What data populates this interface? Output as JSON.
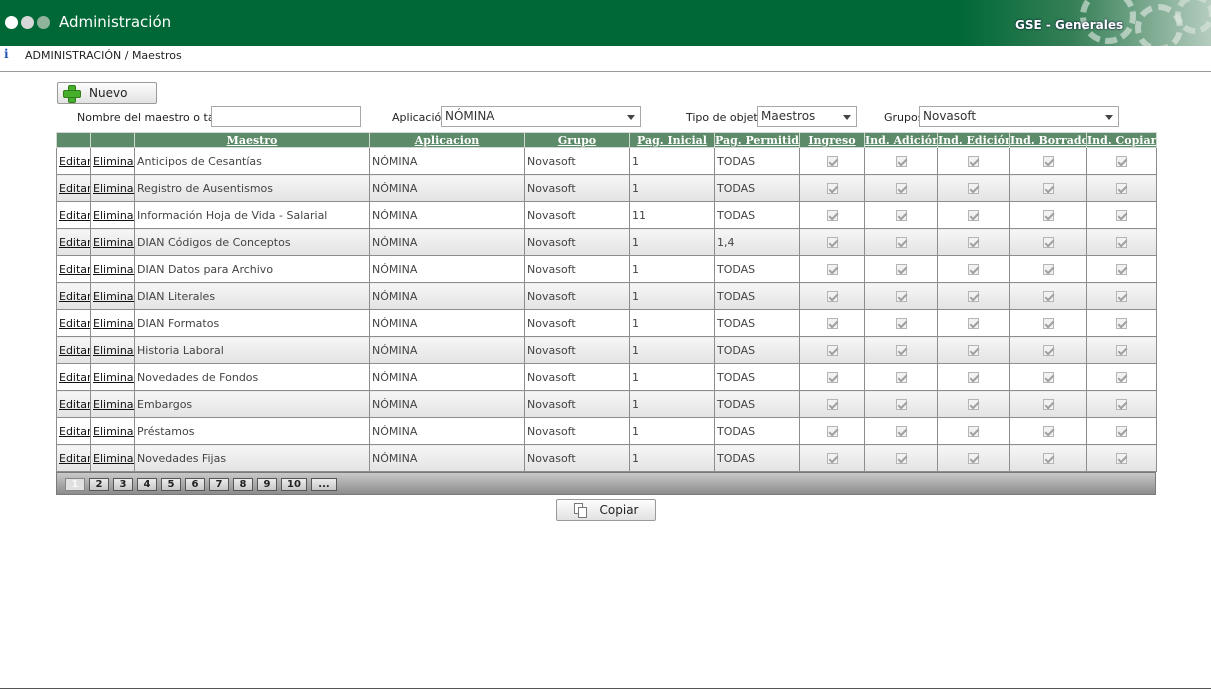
{
  "header": {
    "app_title": "Administración",
    "module_title": "GSE - Generales"
  },
  "breadcrumb": "ADMINISTRACIÓN / Maestros",
  "toolbar": {
    "new_label": "Nuevo",
    "copy_label": "Copiar"
  },
  "filters": {
    "name_label": "Nombre del maestro o tabla",
    "name_value": "",
    "app_label": "Aplicación",
    "app_value": "NÓMINA",
    "type_label": "Tipo de objeto",
    "type_value": "Maestros",
    "group_label": "Grupos",
    "group_value": "Novasoft"
  },
  "grid": {
    "columns": [
      "",
      "",
      "Maestro",
      "Aplicacion",
      "Grupo",
      "Pag. Inicial",
      "Pag. Permitida",
      "Ingreso",
      "Ind. Adición",
      "Ind. Edición",
      "Ind. Borrado",
      "Ind. Copiar"
    ],
    "edit_label": "Editar",
    "delete_label": "Eliminar",
    "rows": [
      {
        "maestro": "Anticipos de Cesantías",
        "aplicacion": "NÓMINA",
        "grupo": "Novasoft",
        "pag_inicial": "1",
        "pag_permitida": "TODAS",
        "ingreso": true,
        "adicion": true,
        "edicion": true,
        "borrado": true,
        "copiar": true
      },
      {
        "maestro": "Registro de Ausentismos",
        "aplicacion": "NÓMINA",
        "grupo": "Novasoft",
        "pag_inicial": "1",
        "pag_permitida": "TODAS",
        "ingreso": true,
        "adicion": true,
        "edicion": true,
        "borrado": true,
        "copiar": true
      },
      {
        "maestro": "Información Hoja de Vida - Salarial",
        "aplicacion": "NÓMINA",
        "grupo": "Novasoft",
        "pag_inicial": "11",
        "pag_permitida": "TODAS",
        "ingreso": true,
        "adicion": true,
        "edicion": true,
        "borrado": true,
        "copiar": true
      },
      {
        "maestro": "DIAN Códigos de Conceptos",
        "aplicacion": "NÓMINA",
        "grupo": "Novasoft",
        "pag_inicial": "1",
        "pag_permitida": "1,4",
        "ingreso": true,
        "adicion": true,
        "edicion": true,
        "borrado": true,
        "copiar": true
      },
      {
        "maestro": "DIAN Datos para Archivo",
        "aplicacion": "NÓMINA",
        "grupo": "Novasoft",
        "pag_inicial": "1",
        "pag_permitida": "TODAS",
        "ingreso": true,
        "adicion": true,
        "edicion": true,
        "borrado": true,
        "copiar": true
      },
      {
        "maestro": "DIAN Literales",
        "aplicacion": "NÓMINA",
        "grupo": "Novasoft",
        "pag_inicial": "1",
        "pag_permitida": "TODAS",
        "ingreso": true,
        "adicion": true,
        "edicion": true,
        "borrado": true,
        "copiar": true
      },
      {
        "maestro": "DIAN Formatos",
        "aplicacion": "NÓMINA",
        "grupo": "Novasoft",
        "pag_inicial": "1",
        "pag_permitida": "TODAS",
        "ingreso": true,
        "adicion": true,
        "edicion": true,
        "borrado": true,
        "copiar": true
      },
      {
        "maestro": "Historia Laboral",
        "aplicacion": "NÓMINA",
        "grupo": "Novasoft",
        "pag_inicial": "1",
        "pag_permitida": "TODAS",
        "ingreso": true,
        "adicion": true,
        "edicion": true,
        "borrado": true,
        "copiar": true
      },
      {
        "maestro": "Novedades de Fondos",
        "aplicacion": "NÓMINA",
        "grupo": "Novasoft",
        "pag_inicial": "1",
        "pag_permitida": "TODAS",
        "ingreso": true,
        "adicion": true,
        "edicion": true,
        "borrado": true,
        "copiar": true
      },
      {
        "maestro": "Embargos",
        "aplicacion": "NÓMINA",
        "grupo": "Novasoft",
        "pag_inicial": "1",
        "pag_permitida": "TODAS",
        "ingreso": true,
        "adicion": true,
        "edicion": true,
        "borrado": true,
        "copiar": true
      },
      {
        "maestro": "Préstamos",
        "aplicacion": "NÓMINA",
        "grupo": "Novasoft",
        "pag_inicial": "1",
        "pag_permitida": "TODAS",
        "ingreso": true,
        "adicion": true,
        "edicion": true,
        "borrado": true,
        "copiar": true
      },
      {
        "maestro": "Novedades Fijas",
        "aplicacion": "NÓMINA",
        "grupo": "Novasoft",
        "pag_inicial": "1",
        "pag_permitida": "TODAS",
        "ingreso": true,
        "adicion": true,
        "edicion": true,
        "borrado": true,
        "copiar": true
      }
    ]
  },
  "pager": {
    "pages": [
      "1",
      "2",
      "3",
      "4",
      "5",
      "6",
      "7",
      "8",
      "9",
      "10",
      "..."
    ],
    "current": "1"
  },
  "colors": {
    "header_bg": "#006837",
    "grid_header_bg": "#5d8a68"
  }
}
